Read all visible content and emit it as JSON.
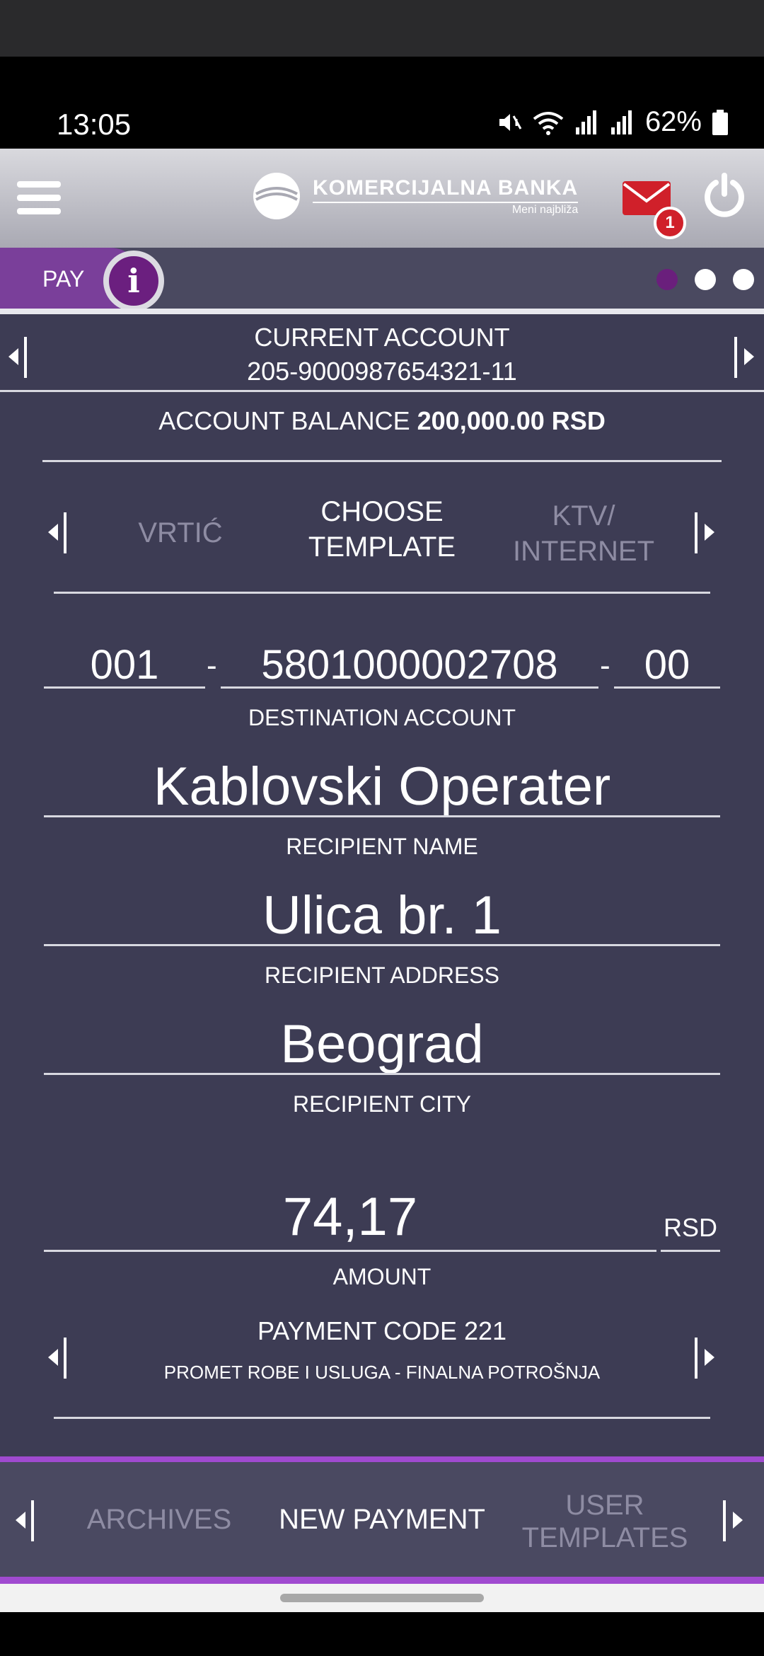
{
  "status_bar": {
    "time": "13:05",
    "battery": "62%"
  },
  "header": {
    "logo_name": "KOMERCIJALNA BANKA",
    "logo_tagline": "Meni najbliža",
    "mail_badge": "1"
  },
  "tabs": {
    "pay_label": "PAY",
    "info_label": "i",
    "pages": 3,
    "active_page": 1
  },
  "account": {
    "title": "CURRENT ACCOUNT",
    "number": "205-9000987654321-11",
    "balance_label": "ACCOUNT BALANCE",
    "balance_value": "200,000.00 RSD"
  },
  "templates": {
    "prev": "VRTIĆ",
    "current_line1": "CHOOSE",
    "current_line2": "TEMPLATE",
    "next_line1": "KTV/",
    "next_line2": "INTERNET"
  },
  "form": {
    "dest_part1": "001",
    "dest_part2": "5801000002708",
    "dest_part3": "00",
    "dest_label": "DESTINATION ACCOUNT",
    "recipient_name": "Kablovski Operater",
    "recipient_name_label": "RECIPIENT NAME",
    "recipient_address": "Ulica br. 1",
    "recipient_address_label": "RECIPIENT ADDRESS",
    "recipient_city": "Beograd",
    "recipient_city_label": "RECIPIENT CITY",
    "amount": "74,17",
    "currency": "RSD",
    "amount_label": "AMOUNT"
  },
  "payment_code": {
    "title": "PAYMENT CODE 221",
    "description": "PROMET ROBE I USLUGA - FINALNA POTROŠNJA"
  },
  "bottom_nav": {
    "archives": "ARCHIVES",
    "new_payment": "NEW PAYMENT",
    "user_templates_line1": "USER",
    "user_templates_line2": "TEMPLATES"
  },
  "colors": {
    "accent": "#7a3f9a",
    "background": "#3d3c54",
    "badge": "#d0202a"
  }
}
